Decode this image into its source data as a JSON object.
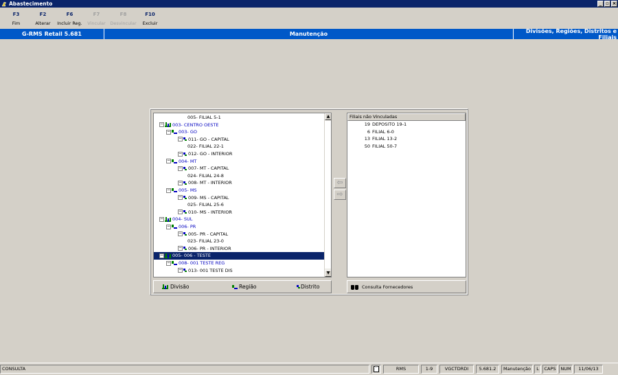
{
  "window": {
    "title": "Abastecimento"
  },
  "toolbar": [
    {
      "key": "F3",
      "label": "Fim",
      "enabled": true
    },
    {
      "key": "F2",
      "label": "Alterar",
      "enabled": true
    },
    {
      "key": "F6",
      "label": "Incluir Reg.",
      "enabled": true
    },
    {
      "key": "F7",
      "label": "Vincular",
      "enabled": false
    },
    {
      "key": "F8",
      "label": "Desvincular",
      "enabled": false
    },
    {
      "key": "F10",
      "label": "Excluir",
      "enabled": true
    }
  ],
  "header": {
    "app": "G-RMS Retail 5.681",
    "mode": "Manutenção",
    "screen": "Divisões, Regiões, Distritos e Filiais"
  },
  "tree": {
    "items": [
      {
        "label": "005- FILIAL 5-1",
        "type": "filial"
      },
      {
        "label": "003- CENTRO OESTE",
        "type": "divisao"
      },
      {
        "label": "003- GO",
        "type": "regiao"
      },
      {
        "label": "011- GO - CAPITAL",
        "type": "distrito"
      },
      {
        "label": "022- FILIAL 22-1",
        "type": "filial"
      },
      {
        "label": "012- GO - INTERIOR",
        "type": "distrito"
      },
      {
        "label": "004- MT",
        "type": "regiao"
      },
      {
        "label": "007- MT - CAPITAL",
        "type": "distrito"
      },
      {
        "label": "024- FILIAL 24-8",
        "type": "filial"
      },
      {
        "label": "008- MT - INTERIOR",
        "type": "distrito"
      },
      {
        "label": "005- MS",
        "type": "regiao"
      },
      {
        "label": "009- MS - CAPITAL",
        "type": "distrito"
      },
      {
        "label": "025- FILIAL 25-6",
        "type": "filial"
      },
      {
        "label": "010- MS - INTERIOR",
        "type": "distrito"
      },
      {
        "label": "004- SUL",
        "type": "divisao"
      },
      {
        "label": "006- PR",
        "type": "regiao"
      },
      {
        "label": "005- PR - CAPITAL",
        "type": "distrito"
      },
      {
        "label": "023- FILIAL 23-0",
        "type": "filial"
      },
      {
        "label": "006- PR - INTERIOR",
        "type": "distrito"
      },
      {
        "label": "005- 006 - TESTE",
        "type": "divisao",
        "selected": true
      },
      {
        "label": "008- 001 TESTE REG",
        "type": "regiao"
      },
      {
        "label": "013- 001 TESTE DIS",
        "type": "distrito"
      }
    ]
  },
  "filiais": {
    "header": "Filiais não Vinculadas",
    "items": [
      {
        "code": "19",
        "name": "DEPOSITO 19-1"
      },
      {
        "code": "6",
        "name": "FILIAL 6-0"
      },
      {
        "code": "13",
        "name": "FILIAL 13-2"
      },
      {
        "code": "50",
        "name": "FILIAL 50-7"
      }
    ]
  },
  "legend": {
    "divisao": "Divisão",
    "regiao": "Região",
    "distrito": "Distrito"
  },
  "buttons": {
    "consulta": "Consulta Fornecedores"
  },
  "statusbar": {
    "mode": "CONSULTA",
    "app": "RMS",
    "range": "1-9",
    "program": "VGCTDRDI",
    "version": "5.681.2",
    "screen": "Manutenção",
    "l": "L",
    "caps": "CAPS",
    "num": "NUM",
    "date": "11/06/13"
  },
  "colors": {
    "header_blue": "#0058c8",
    "title_blue": "#0a246a",
    "tree_blue": "#0000c0",
    "icon_green": "#008000"
  }
}
